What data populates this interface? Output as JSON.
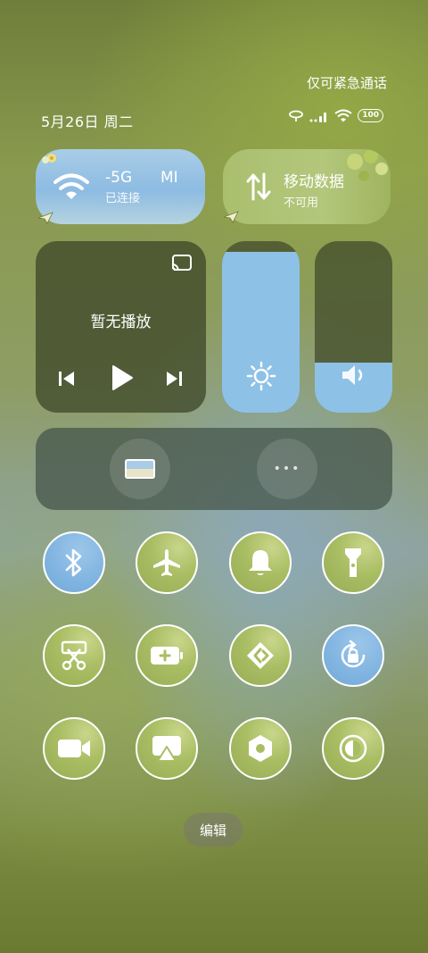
{
  "status": {
    "emergency_text": "仅可紧急通话",
    "date": "5月26日 周二",
    "battery": "100"
  },
  "wifi": {
    "title": "-5G",
    "ssid_fragment": "MI",
    "subtitle": "已连接"
  },
  "mobile_data": {
    "title": "移动数据",
    "subtitle": "不可用"
  },
  "media": {
    "title": "暂无播放"
  },
  "brightness": {
    "level": 0.94
  },
  "volume": {
    "level": 0.29
  },
  "shortcuts": {
    "more_label": "•••"
  },
  "toggles": [
    {
      "name": "bluetooth",
      "active": true
    },
    {
      "name": "airplane-mode",
      "active": false
    },
    {
      "name": "silent-bell",
      "active": false
    },
    {
      "name": "flashlight",
      "active": false
    },
    {
      "name": "screenshot",
      "active": false
    },
    {
      "name": "battery-saver",
      "active": false
    },
    {
      "name": "nearby-share",
      "active": false
    },
    {
      "name": "rotation-lock",
      "active": true
    },
    {
      "name": "screen-record",
      "active": false
    },
    {
      "name": "screen-cast",
      "active": false
    },
    {
      "name": "settings",
      "active": false
    },
    {
      "name": "dark-mode",
      "active": false
    }
  ],
  "edit_label": "编辑",
  "colors": {
    "accent_blue": "#8ec1e6",
    "leaf_green": "#a9bd63"
  }
}
